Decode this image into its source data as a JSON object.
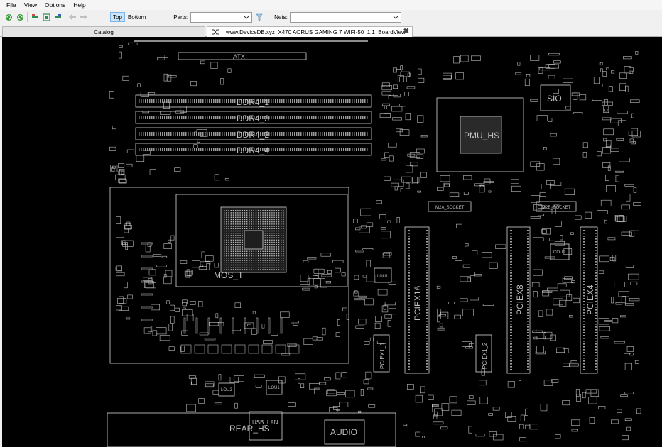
{
  "menu": {
    "items": [
      "File",
      "View",
      "Options",
      "Help"
    ]
  },
  "toolbar": {
    "top_label": "Top",
    "bottom_label": "Bottom",
    "parts_label": "Parts:",
    "parts_value": "",
    "nets_label": "Nets:",
    "nets_value": ""
  },
  "tabs": {
    "catalog_label": "Catalog",
    "board_label": "www.DeviceDB.xyz_X470 AORUS GAMING 7 WIFI-50_1.1_BoardView"
  },
  "board": {
    "labels": {
      "atx": "ATX",
      "ddr4_1": "DDR4_1",
      "ddr4_3": "DDR4_3",
      "ddr4_2": "DDR4_2",
      "ddr4_4": "DDR4_4",
      "pmu_hs": "PMU_HS",
      "sio": "SIO",
      "mos_t": "MOS_T",
      "m2a_socket": "M2A_SOCKET",
      "m2b_socket": "M2B_SOCKET",
      "pciex16": "PCIEX16",
      "pciex8": "PCIEX8",
      "pciex4": "PCIEX4",
      "pciex1_1": "PCIEX1_1",
      "pciex1_2": "PCIEX1_2",
      "rear_hs": "REAR_HS",
      "usb_lan": "USB_LAN",
      "audio": "AUDIO",
      "lou1": "LOU1",
      "lou2": "LOU2",
      "lnu1": "LNU1",
      "cou1": "COU1"
    }
  },
  "colors": {
    "board_bg": "#000000",
    "silkscreen": "#d8d8d8",
    "active_button": "#cce4f7"
  }
}
